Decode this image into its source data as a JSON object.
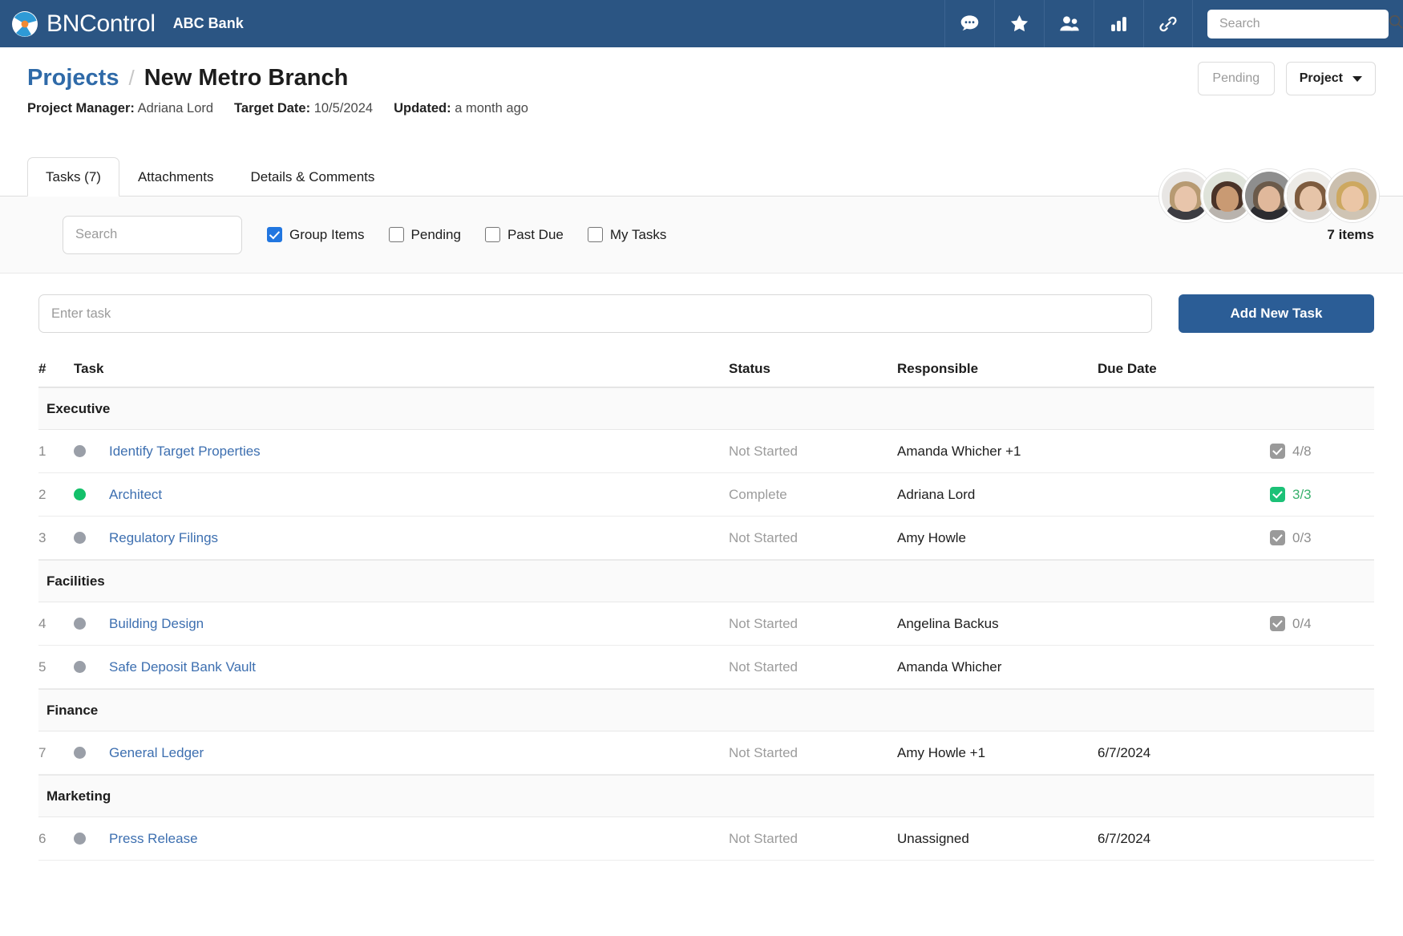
{
  "topbar": {
    "brand": "BNControl",
    "org": "ABC Bank",
    "icons": [
      {
        "name": "chat-icon",
        "label": "Messages"
      },
      {
        "name": "star-icon",
        "label": "Favorites"
      },
      {
        "name": "people-icon",
        "label": "Contacts"
      },
      {
        "name": "bar-chart-icon",
        "label": "Reports"
      },
      {
        "name": "link-icon",
        "label": "Links"
      }
    ],
    "search": {
      "value": "",
      "placeholder": "Search"
    }
  },
  "page": {
    "breadcrumb_parent": "Projects",
    "breadcrumb_sep": "/",
    "title": "New Metro Branch",
    "meta": {
      "manager_label": "Project Manager:",
      "manager_value": "Adriana Lord",
      "target_label": "Target Date:",
      "target_value": "10/5/2024",
      "updated_label": "Updated:",
      "updated_value": "a month ago"
    },
    "status_button": "Pending",
    "type_button": "Project",
    "avatars": [
      {
        "name": "avatar-1",
        "bg": "#e8e6e4",
        "hair": "#b79a72",
        "skin": "#e8c5ab",
        "body": "#3c3c42"
      },
      {
        "name": "avatar-2",
        "bg": "#dfe3da",
        "hair": "#4a3328",
        "skin": "#c99a73",
        "body": "#b9b3ad"
      },
      {
        "name": "avatar-3",
        "bg": "#8e8e8e",
        "hair": "#6b5a4a",
        "skin": "#e0b89b",
        "body": "#2c2c30"
      },
      {
        "name": "avatar-4",
        "bg": "#eceae6",
        "hair": "#7d5b3e",
        "skin": "#e6c4a8",
        "body": "#d8d3cd"
      },
      {
        "name": "avatar-5",
        "bg": "#cbbfae",
        "hair": "#cda860",
        "skin": "#ebc6a6",
        "body": "#cfc4b4"
      }
    ]
  },
  "tabs": [
    {
      "label": "Tasks (7)",
      "active": true
    },
    {
      "label": "Attachments",
      "active": false
    },
    {
      "label": "Details & Comments",
      "active": false
    }
  ],
  "filters": {
    "search": {
      "value": "",
      "placeholder": "Search"
    },
    "checkboxes": [
      {
        "label": "Group Items",
        "checked": true
      },
      {
        "label": "Pending",
        "checked": false
      },
      {
        "label": "Past Due",
        "checked": false
      },
      {
        "label": "My Tasks",
        "checked": false
      }
    ],
    "items_count": "7 items"
  },
  "add_task": {
    "input_value": "",
    "input_placeholder": "Enter task",
    "button_label": "Add New Task"
  },
  "table": {
    "columns": {
      "num": "#",
      "task": "Task",
      "status": "Status",
      "responsible": "Responsible",
      "due": "Due Date"
    },
    "groups": [
      {
        "name": "Executive",
        "rows": [
          {
            "num": "1",
            "dot": "grey",
            "task": "Identify Target Properties",
            "status": "Not Started",
            "responsible": "Amanda Whicher +1",
            "due": "",
            "checklist": "4/8",
            "checklist_done": false
          },
          {
            "num": "2",
            "dot": "green",
            "task": "Architect",
            "status": "Complete",
            "responsible": "Adriana Lord",
            "due": "",
            "checklist": "3/3",
            "checklist_done": true
          },
          {
            "num": "3",
            "dot": "grey",
            "task": "Regulatory Filings",
            "status": "Not Started",
            "responsible": "Amy Howle",
            "due": "",
            "checklist": "0/3",
            "checklist_done": false
          }
        ]
      },
      {
        "name": "Facilities",
        "rows": [
          {
            "num": "4",
            "dot": "grey",
            "task": "Building Design",
            "status": "Not Started",
            "responsible": "Angelina Backus",
            "due": "",
            "checklist": "0/4",
            "checklist_done": false
          },
          {
            "num": "5",
            "dot": "grey",
            "task": "Safe Deposit Bank Vault",
            "status": "Not Started",
            "responsible": "Amanda Whicher",
            "due": "",
            "checklist": "",
            "checklist_done": false
          }
        ]
      },
      {
        "name": "Finance",
        "rows": [
          {
            "num": "7",
            "dot": "grey",
            "task": "General Ledger",
            "status": "Not Started",
            "responsible": "Amy Howle +1",
            "due": "6/7/2024",
            "checklist": "",
            "checklist_done": false
          }
        ]
      },
      {
        "name": "Marketing",
        "rows": [
          {
            "num": "6",
            "dot": "grey",
            "task": "Press Release",
            "status": "Not Started",
            "responsible": "Unassigned",
            "due": "6/7/2024",
            "checklist": "",
            "checklist_done": false
          }
        ]
      }
    ]
  },
  "colors": {
    "header_blue": "#2b5583",
    "primary_blue": "#2b5d96",
    "link_blue": "#3d6fb0",
    "accent_check": "#2176e0",
    "complete_green": "#13c06a"
  }
}
